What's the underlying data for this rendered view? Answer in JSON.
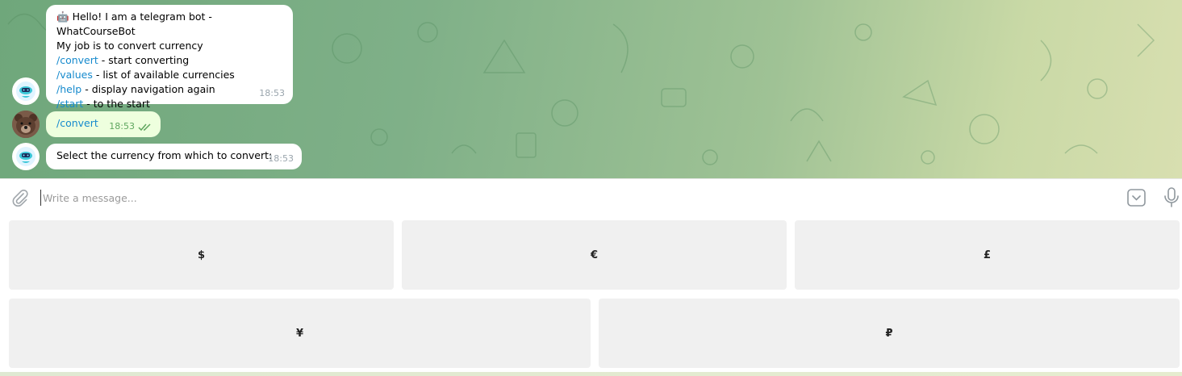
{
  "chat": {
    "messages": [
      {
        "sender": "bot",
        "avatar_icon": "robot-icon",
        "greeting_emoji": "🤖",
        "lines": [
          {
            "text": "Hello! I am a telegram bot - WhatCourseBot"
          },
          {
            "text": "My job is to convert currency"
          },
          {
            "command": "/convert",
            "text": " - start converting"
          },
          {
            "command": "/values",
            "text": " - list of available currencies"
          },
          {
            "command": "/help",
            "text": " - display navigation again"
          },
          {
            "command": "/start",
            "text": " - to the start"
          }
        ],
        "time": "18:53"
      },
      {
        "sender": "user",
        "avatar_icon": "bear-avatar",
        "text": "/convert",
        "time": "18:53",
        "status_icon": "double-check-icon"
      },
      {
        "sender": "bot",
        "avatar_icon": "robot-icon",
        "text": "Select the currency from which to convert:",
        "time": "18:53"
      }
    ]
  },
  "composer": {
    "placeholder": "Write a message...",
    "value": ""
  },
  "keyboard": {
    "rows": [
      [
        "$",
        "€",
        "£"
      ],
      [
        "¥",
        "₽"
      ]
    ]
  },
  "colors": {
    "command_link": "#168acd",
    "outgoing_bubble": "#eeffde",
    "key_button": "#f0f0f0"
  }
}
